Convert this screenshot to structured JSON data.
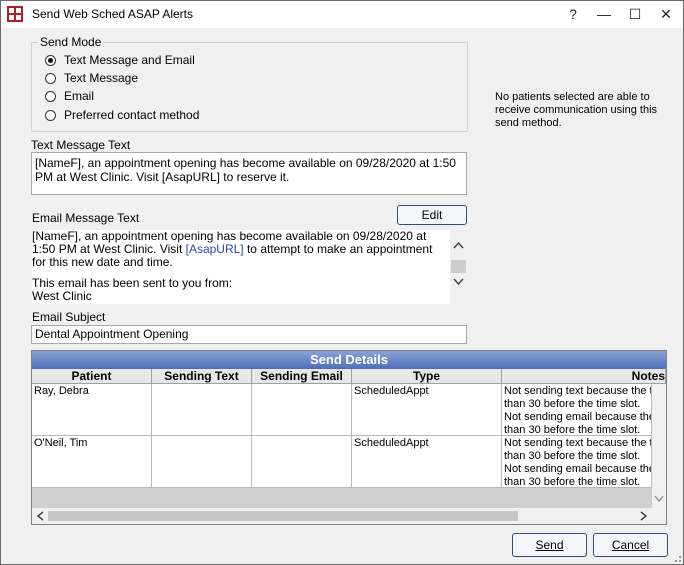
{
  "window": {
    "title": "Send Web Sched ASAP Alerts",
    "help": "?",
    "minimize": "—",
    "maximize": "☐",
    "close": "✕"
  },
  "send_mode": {
    "legend": "Send Mode",
    "options": [
      {
        "label": "Text Message and Email",
        "selected": true
      },
      {
        "label": "Text Message",
        "selected": false
      },
      {
        "label": "Email",
        "selected": false
      },
      {
        "label": "Preferred contact method",
        "selected": false
      }
    ]
  },
  "notice": "No patients selected are able to receive communication using this send method.",
  "text_message": {
    "label": "Text Message Text",
    "value": "[NameF], an appointment opening has become available on 09/28/2020 at 1:50 PM at West Clinic. Visit [AsapURL] to reserve it."
  },
  "email_message": {
    "label": "Email Message Text",
    "edit_button": "Edit",
    "line1a": "[NameF], an appointment opening has become available on 09/28/2020 at",
    "line1b_pre": "1:50 PM at West Clinic. Visit ",
    "line1b_link": "[AsapURL]",
    "line1b_post": " to attempt to make an appointment",
    "line1c": "for this new date and time.",
    "line2": "This email has been sent to you from:",
    "line3": "West Clinic"
  },
  "email_subject": {
    "label": "Email Subject",
    "value": "Dental Appointment Opening"
  },
  "send_details": {
    "title": "Send Details",
    "columns": [
      "Patient",
      "Sending Text",
      "Sending Email",
      "Type",
      "Notes"
    ],
    "rows": [
      {
        "patient": "Ray, Debra",
        "sending_text": "",
        "sending_email": "",
        "type": "ScheduledAppt",
        "notes": [
          "Not sending text because the t",
          "than 30 before the time slot.",
          "Not sending email because the",
          "than 30 before the time slot."
        ]
      },
      {
        "patient": "O'Neil, Tim",
        "sending_text": "",
        "sending_email": "",
        "type": "ScheduledAppt",
        "notes": [
          "Not sending text because the t",
          "than 30 before the time slot.",
          "Not sending email because the",
          "than 30 before the time slot."
        ]
      }
    ]
  },
  "buttons": {
    "send": "Send",
    "cancel": "Cancel"
  },
  "colors": {
    "grid_title_bg": "#5f7fc0",
    "button_border": "#2f4f7f"
  }
}
